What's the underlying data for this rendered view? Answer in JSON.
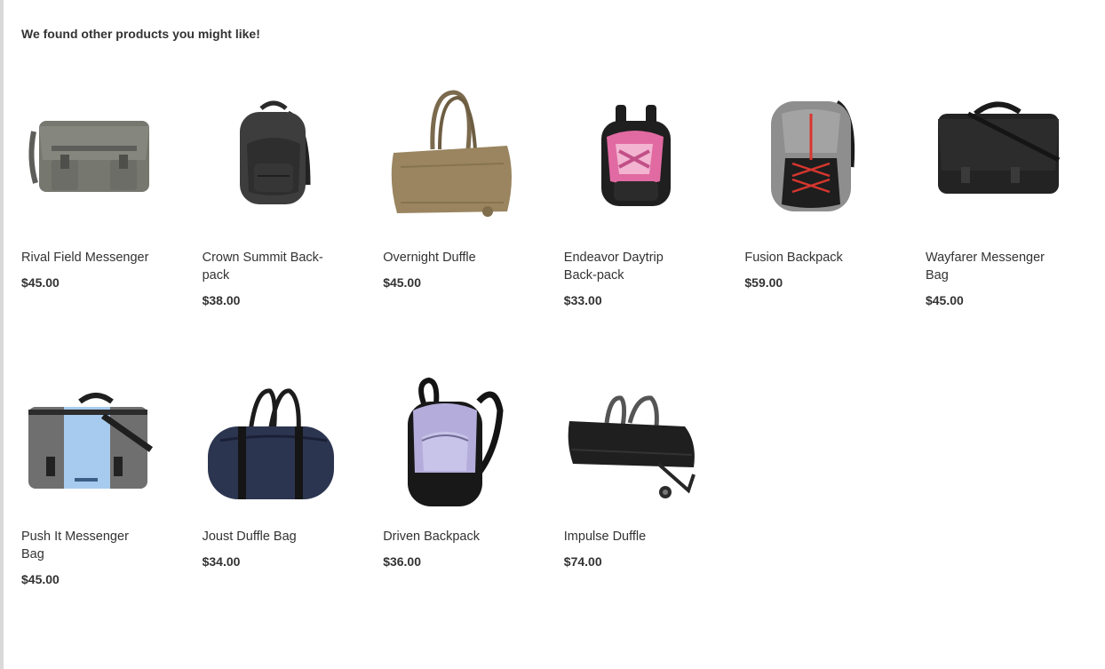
{
  "heading": "We found other products you might like!",
  "products": [
    {
      "name": "Rival Field Messenger",
      "price": "$45.00",
      "icon": "messenger-bag-icon",
      "color": "#6f706b"
    },
    {
      "name": "Crown Summit Back-pack",
      "price": "$38.00",
      "icon": "backpack-icon",
      "color": "#3a3a3a"
    },
    {
      "name": "Overnight Duffle",
      "price": "$45.00",
      "icon": "duffle-bag-icon",
      "color": "#9a8560"
    },
    {
      "name": "Endeavor Daytrip Back-pack",
      "price": "$33.00",
      "icon": "backpack-icon",
      "color": "#d9659b"
    },
    {
      "name": "Fusion Backpack",
      "price": "$59.00",
      "icon": "backpack-icon",
      "color": "#8e8e8e"
    },
    {
      "name": "Wayfarer Messenger Bag",
      "price": "$45.00",
      "icon": "messenger-bag-icon",
      "color": "#222222"
    },
    {
      "name": "Push It Messenger Bag",
      "price": "$45.00",
      "icon": "messenger-bag-icon",
      "color": "#9ec3e8"
    },
    {
      "name": "Joust Duffle Bag",
      "price": "$34.00",
      "icon": "duffle-bag-icon",
      "color": "#2c3550"
    },
    {
      "name": "Driven Backpack",
      "price": "$36.00",
      "icon": "backpack-icon",
      "color": "#b4addb"
    },
    {
      "name": "Impulse Duffle",
      "price": "$74.00",
      "icon": "rolling-duffle-icon",
      "color": "#1f1f1f"
    }
  ]
}
